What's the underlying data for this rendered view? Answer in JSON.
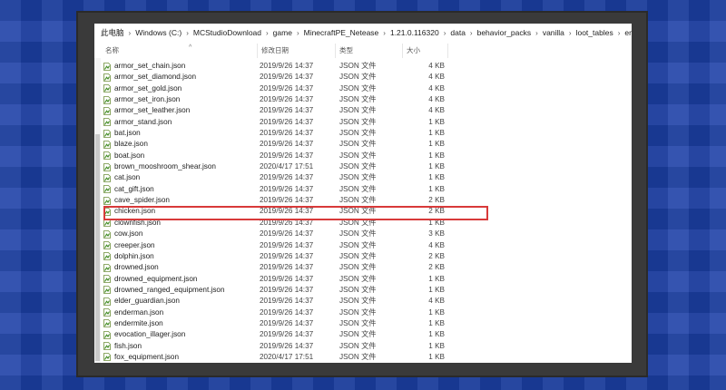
{
  "breadcrumb": [
    "此电脑",
    "Windows (C:)",
    "MCStudioDownload",
    "game",
    "MinecraftPE_Netease",
    "1.21.0.116320",
    "data",
    "behavior_packs",
    "vanilla",
    "loot_tables",
    "entities"
  ],
  "columns": {
    "name": "名称",
    "date": "修改日期",
    "type": "类型",
    "size": "大小"
  },
  "icons": {
    "breadcrumb_separator": "chevron-right-icon",
    "file": "json-file-icon",
    "sort": "sort-up-icon"
  },
  "colors": {
    "highlight": "#d83a3a"
  },
  "files": [
    {
      "name": "armor_set_chain.json",
      "date": "2019/9/26 14:37",
      "type": "JSON 文件",
      "size": "4 KB"
    },
    {
      "name": "armor_set_diamond.json",
      "date": "2019/9/26 14:37",
      "type": "JSON 文件",
      "size": "4 KB"
    },
    {
      "name": "armor_set_gold.json",
      "date": "2019/9/26 14:37",
      "type": "JSON 文件",
      "size": "4 KB"
    },
    {
      "name": "armor_set_iron.json",
      "date": "2019/9/26 14:37",
      "type": "JSON 文件",
      "size": "4 KB"
    },
    {
      "name": "armor_set_leather.json",
      "date": "2019/9/26 14:37",
      "type": "JSON 文件",
      "size": "4 KB"
    },
    {
      "name": "armor_stand.json",
      "date": "2019/9/26 14:37",
      "type": "JSON 文件",
      "size": "1 KB"
    },
    {
      "name": "bat.json",
      "date": "2019/9/26 14:37",
      "type": "JSON 文件",
      "size": "1 KB"
    },
    {
      "name": "blaze.json",
      "date": "2019/9/26 14:37",
      "type": "JSON 文件",
      "size": "1 KB"
    },
    {
      "name": "boat.json",
      "date": "2019/9/26 14:37",
      "type": "JSON 文件",
      "size": "1 KB"
    },
    {
      "name": "brown_mooshroom_shear.json",
      "date": "2020/4/17 17:51",
      "type": "JSON 文件",
      "size": "1 KB"
    },
    {
      "name": "cat.json",
      "date": "2019/9/26 14:37",
      "type": "JSON 文件",
      "size": "1 KB"
    },
    {
      "name": "cat_gift.json",
      "date": "2019/9/26 14:37",
      "type": "JSON 文件",
      "size": "1 KB"
    },
    {
      "name": "cave_spider.json",
      "date": "2019/9/26 14:37",
      "type": "JSON 文件",
      "size": "2 KB"
    },
    {
      "name": "chicken.json",
      "date": "2019/9/26 14:37",
      "type": "JSON 文件",
      "size": "2 KB"
    },
    {
      "name": "clownfish.json",
      "date": "2019/9/26 14:37",
      "type": "JSON 文件",
      "size": "1 KB"
    },
    {
      "name": "cow.json",
      "date": "2019/9/26 14:37",
      "type": "JSON 文件",
      "size": "3 KB"
    },
    {
      "name": "creeper.json",
      "date": "2019/9/26 14:37",
      "type": "JSON 文件",
      "size": "4 KB"
    },
    {
      "name": "dolphin.json",
      "date": "2019/9/26 14:37",
      "type": "JSON 文件",
      "size": "2 KB"
    },
    {
      "name": "drowned.json",
      "date": "2019/9/26 14:37",
      "type": "JSON 文件",
      "size": "2 KB"
    },
    {
      "name": "drowned_equipment.json",
      "date": "2019/9/26 14:37",
      "type": "JSON 文件",
      "size": "1 KB"
    },
    {
      "name": "drowned_ranged_equipment.json",
      "date": "2019/9/26 14:37",
      "type": "JSON 文件",
      "size": "1 KB"
    },
    {
      "name": "elder_guardian.json",
      "date": "2019/9/26 14:37",
      "type": "JSON 文件",
      "size": "4 KB"
    },
    {
      "name": "enderman.json",
      "date": "2019/9/26 14:37",
      "type": "JSON 文件",
      "size": "1 KB"
    },
    {
      "name": "endermite.json",
      "date": "2019/9/26 14:37",
      "type": "JSON 文件",
      "size": "1 KB"
    },
    {
      "name": "evocation_illager.json",
      "date": "2019/9/26 14:37",
      "type": "JSON 文件",
      "size": "1 KB"
    },
    {
      "name": "fish.json",
      "date": "2019/9/26 14:37",
      "type": "JSON 文件",
      "size": "1 KB"
    },
    {
      "name": "fox_equipment.json",
      "date": "2020/4/17 17:51",
      "type": "JSON 文件",
      "size": "1 KB"
    }
  ]
}
